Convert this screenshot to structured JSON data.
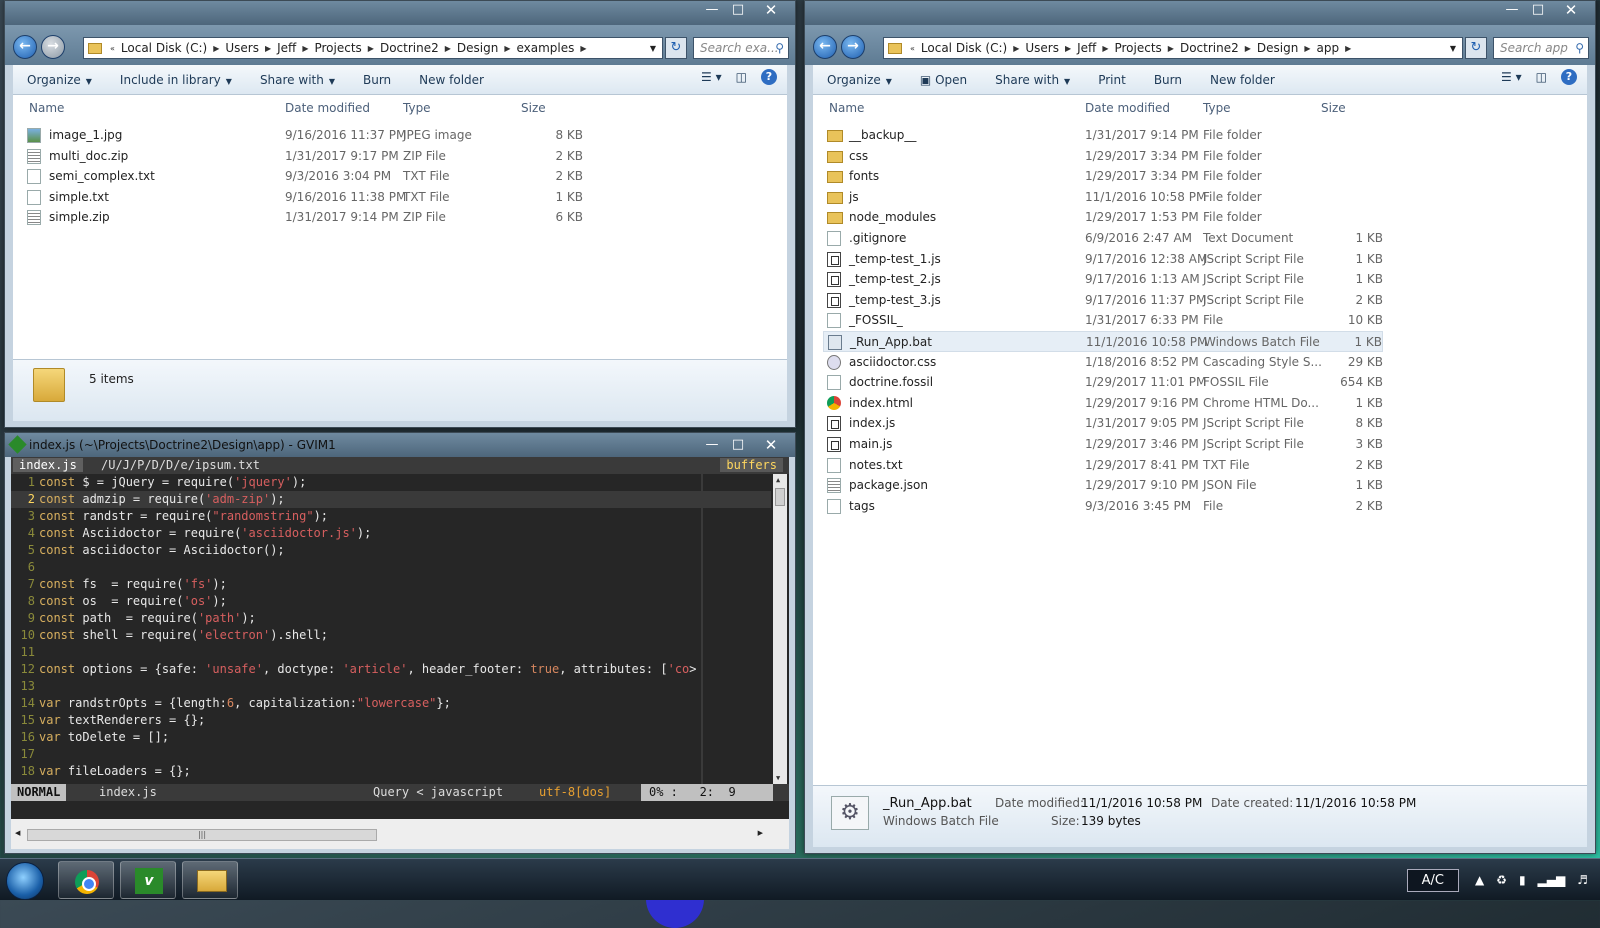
{
  "left_window": {
    "address": [
      "Local Disk (C:)",
      "Users",
      "Jeff",
      "Projects",
      "Doctrine2",
      "Design",
      "examples"
    ],
    "search_placeholder": "Search exa...",
    "toolbar": {
      "organize": "Organize",
      "include": "Include in library",
      "share": "Share with",
      "burn": "Burn",
      "new_folder": "New folder"
    },
    "columns": {
      "name": "Name",
      "date": "Date modified",
      "type": "Type",
      "size": "Size"
    },
    "files": [
      {
        "name": "image_1.jpg",
        "date": "9/16/2016 11:37 PM",
        "type": "JPEG image",
        "size": "8 KB",
        "icon": "image-file-icon"
      },
      {
        "name": "multi_doc.zip",
        "date": "1/31/2017 9:17 PM",
        "type": "ZIP File",
        "size": "2 KB",
        "icon": "zip-file-icon"
      },
      {
        "name": "semi_complex.txt",
        "date": "9/3/2016 3:04 PM",
        "type": "TXT File",
        "size": "2 KB",
        "icon": "text-file-icon"
      },
      {
        "name": "simple.txt",
        "date": "9/16/2016 11:38 PM",
        "type": "TXT File",
        "size": "1 KB",
        "icon": "text-file-icon"
      },
      {
        "name": "simple.zip",
        "date": "1/31/2017 9:14 PM",
        "type": "ZIP File",
        "size": "6 KB",
        "icon": "zip-file-icon"
      }
    ],
    "status": "5 items"
  },
  "right_window": {
    "address": [
      "Local Disk (C:)",
      "Users",
      "Jeff",
      "Projects",
      "Doctrine2",
      "Design",
      "app"
    ],
    "search_placeholder": "Search app",
    "toolbar": {
      "organize": "Organize",
      "open": "Open",
      "share": "Share with",
      "print": "Print",
      "burn": "Burn",
      "new_folder": "New folder"
    },
    "columns": {
      "name": "Name",
      "date": "Date modified",
      "type": "Type",
      "size": "Size"
    },
    "files": [
      {
        "name": "__backup__",
        "date": "1/31/2017 9:14 PM",
        "type": "File folder",
        "size": "",
        "icon": "folder"
      },
      {
        "name": "css",
        "date": "1/29/2017 3:34 PM",
        "type": "File folder",
        "size": "",
        "icon": "folder"
      },
      {
        "name": "fonts",
        "date": "1/29/2017 3:34 PM",
        "type": "File folder",
        "size": "",
        "icon": "folder"
      },
      {
        "name": "js",
        "date": "11/1/2016 10:58 PM",
        "type": "File folder",
        "size": "",
        "icon": "folder"
      },
      {
        "name": "node_modules",
        "date": "1/29/2017 1:53 PM",
        "type": "File folder",
        "size": "",
        "icon": "folder"
      },
      {
        "name": ".gitignore",
        "date": "6/9/2016 2:47 AM",
        "type": "Text Document",
        "size": "1 KB",
        "icon": "file"
      },
      {
        "name": "_temp-test_1.js",
        "date": "9/17/2016 12:38 AM",
        "type": "JScript Script File",
        "size": "1 KB",
        "icon": "js"
      },
      {
        "name": "_temp-test_2.js",
        "date": "9/17/2016 1:13 AM",
        "type": "JScript Script File",
        "size": "1 KB",
        "icon": "js"
      },
      {
        "name": "_temp-test_3.js",
        "date": "9/17/2016 11:37 PM",
        "type": "JScript Script File",
        "size": "2 KB",
        "icon": "js"
      },
      {
        "name": "_FOSSIL_",
        "date": "1/31/2017 6:33 PM",
        "type": "File",
        "size": "10 KB",
        "icon": "file"
      },
      {
        "name": "_Run_App.bat",
        "date": "11/1/2016 10:58 PM",
        "type": "Windows Batch File",
        "size": "1 KB",
        "icon": "bat",
        "selected": true
      },
      {
        "name": "asciidoctor.css",
        "date": "1/18/2016 8:52 PM",
        "type": "Cascading Style S...",
        "size": "29 KB",
        "icon": "css"
      },
      {
        "name": "doctrine.fossil",
        "date": "1/29/2017 11:01 PM",
        "type": "FOSSIL File",
        "size": "654 KB",
        "icon": "file"
      },
      {
        "name": "index.html",
        "date": "1/29/2017 9:16 PM",
        "type": "Chrome HTML Do...",
        "size": "1 KB",
        "icon": "chrome"
      },
      {
        "name": "index.js",
        "date": "1/31/2017 9:05 PM",
        "type": "JScript Script File",
        "size": "8 KB",
        "icon": "js"
      },
      {
        "name": "main.js",
        "date": "1/29/2017 3:46 PM",
        "type": "JScript Script File",
        "size": "3 KB",
        "icon": "js"
      },
      {
        "name": "notes.txt",
        "date": "1/29/2017 8:41 PM",
        "type": "TXT File",
        "size": "2 KB",
        "icon": "file"
      },
      {
        "name": "package.json",
        "date": "1/29/2017 9:10 PM",
        "type": "JSON File",
        "size": "1 KB",
        "icon": "zip"
      },
      {
        "name": "tags",
        "date": "9/3/2016 3:45 PM",
        "type": "File",
        "size": "2 KB",
        "icon": "file"
      }
    ],
    "details": {
      "name": "_Run_App.bat",
      "kind": "Windows Batch File",
      "modified_label": "Date modified:",
      "modified": "11/1/2016 10:58 PM",
      "size_label": "Size:",
      "size": "139 bytes",
      "created_label": "Date created:",
      "created": "11/1/2016 10:58 PM"
    }
  },
  "vim": {
    "title": "index.js (~\\Projects\\Doctrine2\\Design\\app) - GVIM1",
    "tab_active": "index.js",
    "tab_other": "/U/J/P/D/D/e/ipsum.txt",
    "buffers_label": "buffers",
    "lines": [
      [
        [
          "kw",
          "const"
        ],
        [
          "cm",
          " $ = jQuery = require("
        ],
        [
          "str",
          "'jquery'"
        ],
        [
          "cm",
          ");"
        ]
      ],
      [
        [
          "kw",
          "const"
        ],
        [
          "cm",
          " admzip = require("
        ],
        [
          "str",
          "'adm-zip'"
        ],
        [
          "cm",
          ");"
        ]
      ],
      [
        [
          "kw",
          "const"
        ],
        [
          "cm",
          " randstr = require("
        ],
        [
          "str",
          "\"randomstring\""
        ],
        [
          "cm",
          ");"
        ]
      ],
      [
        [
          "kw",
          "const"
        ],
        [
          "cm",
          " Asciidoctor = require("
        ],
        [
          "str",
          "'asciidoctor.js'"
        ],
        [
          "cm",
          ");"
        ]
      ],
      [
        [
          "kw",
          "const"
        ],
        [
          "cm",
          " asciidoctor = Asciidoctor();"
        ]
      ],
      [
        [
          "cm",
          ""
        ]
      ],
      [
        [
          "kw",
          "const"
        ],
        [
          "cm",
          " fs  = require("
        ],
        [
          "str",
          "'fs'"
        ],
        [
          "cm",
          ");"
        ]
      ],
      [
        [
          "kw",
          "const"
        ],
        [
          "cm",
          " os  = require("
        ],
        [
          "str",
          "'os'"
        ],
        [
          "cm",
          ");"
        ]
      ],
      [
        [
          "kw",
          "const"
        ],
        [
          "cm",
          " path  = require("
        ],
        [
          "str",
          "'path'"
        ],
        [
          "cm",
          ");"
        ]
      ],
      [
        [
          "kw",
          "const"
        ],
        [
          "cm",
          " shell = require("
        ],
        [
          "str",
          "'electron'"
        ],
        [
          "cm",
          ").shell;"
        ]
      ],
      [
        [
          "cm",
          ""
        ]
      ],
      [
        [
          "kw",
          "const"
        ],
        [
          "cm",
          " options = {safe: "
        ],
        [
          "str",
          "'unsafe'"
        ],
        [
          "cm",
          ", doctype: "
        ],
        [
          "str",
          "'article'"
        ],
        [
          "cm",
          ", header_footer: "
        ],
        [
          "num",
          "true"
        ],
        [
          "cm",
          ", attributes: ["
        ],
        [
          "str",
          "'co"
        ],
        [
          "cm",
          ">"
        ]
      ],
      [
        [
          "cm",
          ""
        ]
      ],
      [
        [
          "kw",
          "var"
        ],
        [
          "cm",
          " randstrOpts = {length:"
        ],
        [
          "num",
          "6"
        ],
        [
          "cm",
          ", capitalization:"
        ],
        [
          "str",
          "\"lowercase\""
        ],
        [
          "cm",
          "};"
        ]
      ],
      [
        [
          "kw",
          "var"
        ],
        [
          "cm",
          " textRenderers = {};"
        ]
      ],
      [
        [
          "kw",
          "var"
        ],
        [
          "cm",
          " toDelete = [];"
        ]
      ],
      [
        [
          "cm",
          ""
        ]
      ],
      [
        [
          "kw",
          "var"
        ],
        [
          "cm",
          " fileLoaders = {};"
        ]
      ]
    ],
    "current_line": 2,
    "status": {
      "mode": "NORMAL",
      "file": "index.js",
      "filetype": "Query < javascript",
      "encoding": "utf-8[dos]",
      "position": "0% :   2:  9"
    }
  },
  "taskbar": {
    "ac_label": "A/C"
  }
}
